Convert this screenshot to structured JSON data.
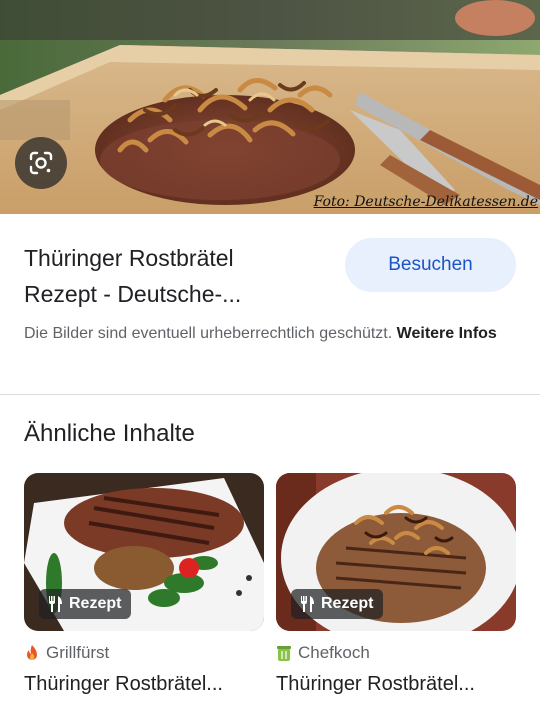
{
  "hero": {
    "photo_credit": "Foto: Deutsche-Delikatessen.de",
    "lens_icon": "google-lens-icon"
  },
  "result": {
    "title_line1": "Thüringer Rostbrätel",
    "title_line2": "Rezept - Deutsche-...",
    "visit_label": "Besuchen",
    "copyright_text": "Die Bilder sind eventuell urheberrechtlich geschützt.",
    "more_info_label": "Weitere Infos"
  },
  "related": {
    "heading": "Ähnliche Inhalte",
    "cards": [
      {
        "badge": "Rezept",
        "badge_icon": "fork-knife-icon",
        "source": "Grillfürst",
        "source_icon": "flame-icon",
        "title": "Thüringer Rostbrätel..."
      },
      {
        "badge": "Rezept",
        "badge_icon": "fork-knife-icon",
        "source": "Chefkoch",
        "source_icon": "chef-pot-icon",
        "title": "Thüringer Rostbrätel..."
      }
    ]
  },
  "colors": {
    "accent": "#1a55c4",
    "button_bg": "#e8f0fe",
    "text_primary": "#202124",
    "text_secondary": "#5f6368"
  }
}
